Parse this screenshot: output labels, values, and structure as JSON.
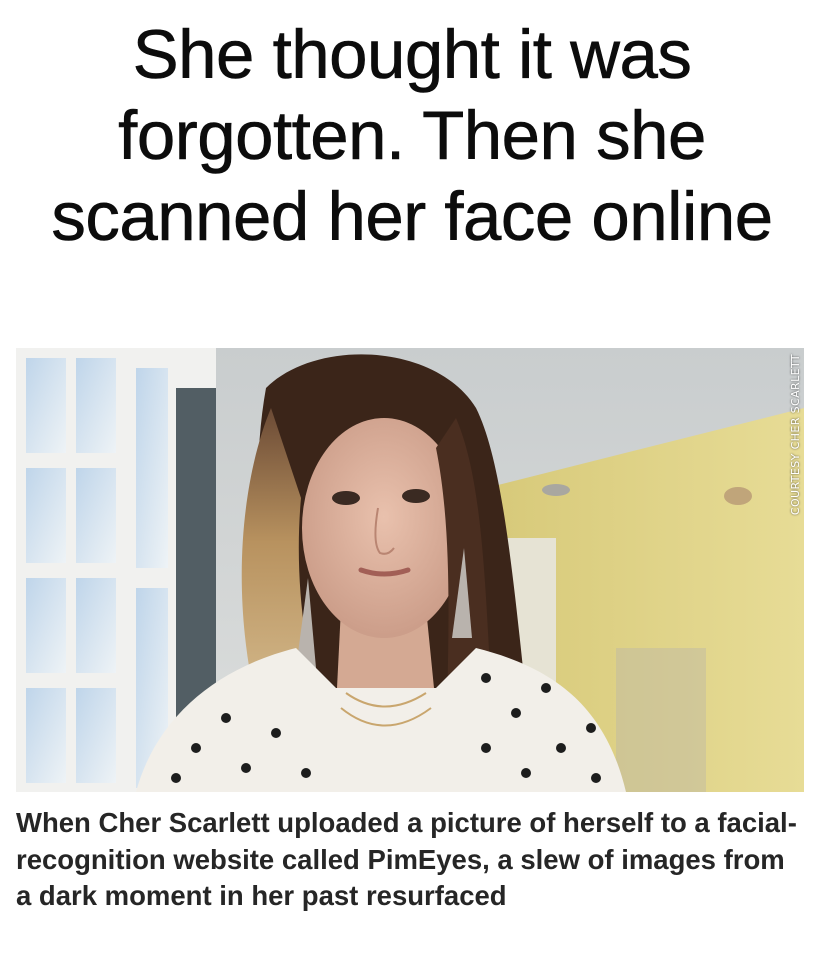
{
  "article": {
    "headline": "She thought it was forgotten. Then she scanned her face online",
    "image_credit": "COURTESY CHER SCARLETT",
    "caption": "When Cher Scarlett uploaded a picture of herself to a facial-recognition website called PimEyes, a slew of images from a dark moment in her past resurfaced"
  },
  "colors": {
    "headline_text": "#0c0c0c",
    "caption_text": "#262626",
    "background": "#ffffff"
  }
}
